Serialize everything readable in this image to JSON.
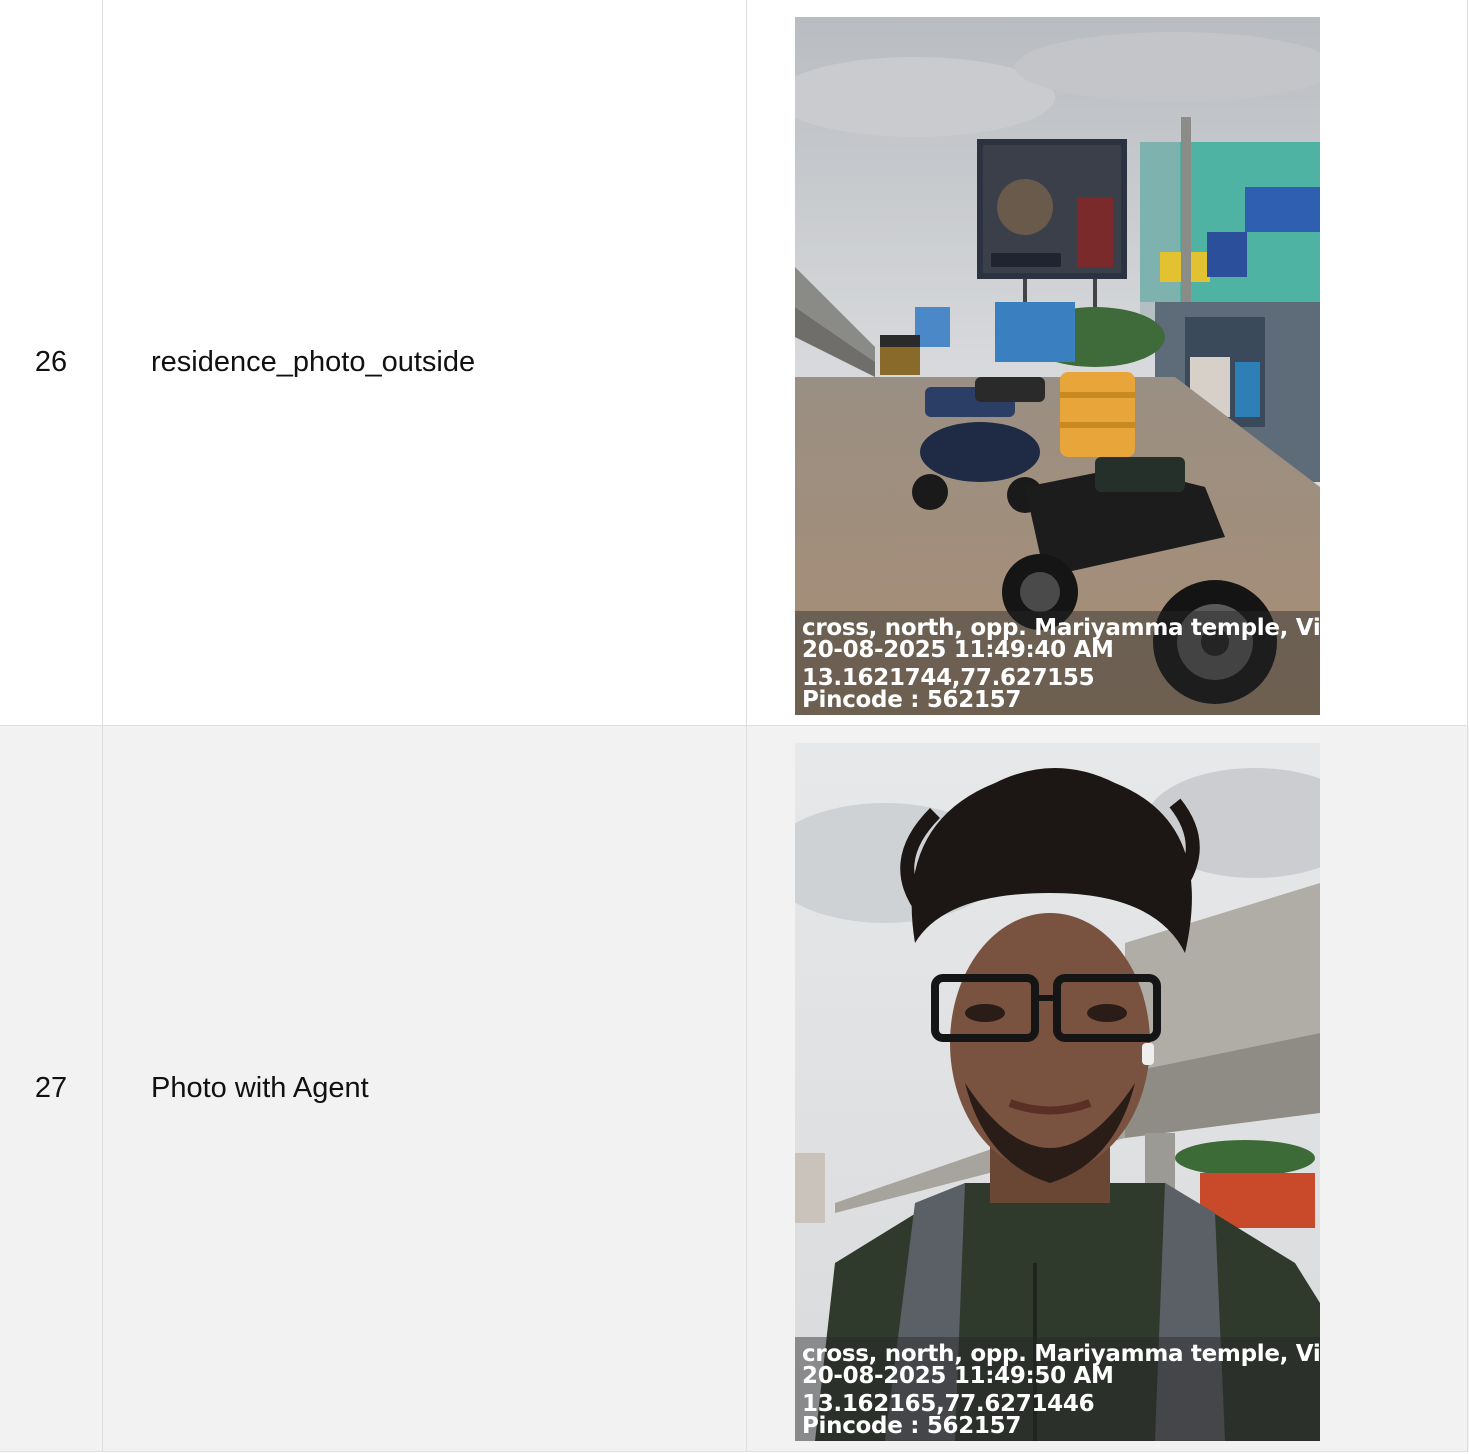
{
  "rows": [
    {
      "number": "26",
      "label": "residence_photo_outside",
      "photo": {
        "line1": "cross, north, opp. Mariyamma temple, Vidya",
        "line2": "20-08-2025 11:49:40 AM",
        "line3": "13.1621744,77.627155",
        "line4": "Pincode : 562157"
      }
    },
    {
      "number": "27",
      "label": "Photo with Agent",
      "photo": {
        "line1": "cross, north, opp. Mariyamma temple, Vidya",
        "line2": "20-08-2025 11:49:50 AM",
        "line3": "13.162165,77.6271446",
        "line4": "Pincode : 562157"
      }
    }
  ]
}
